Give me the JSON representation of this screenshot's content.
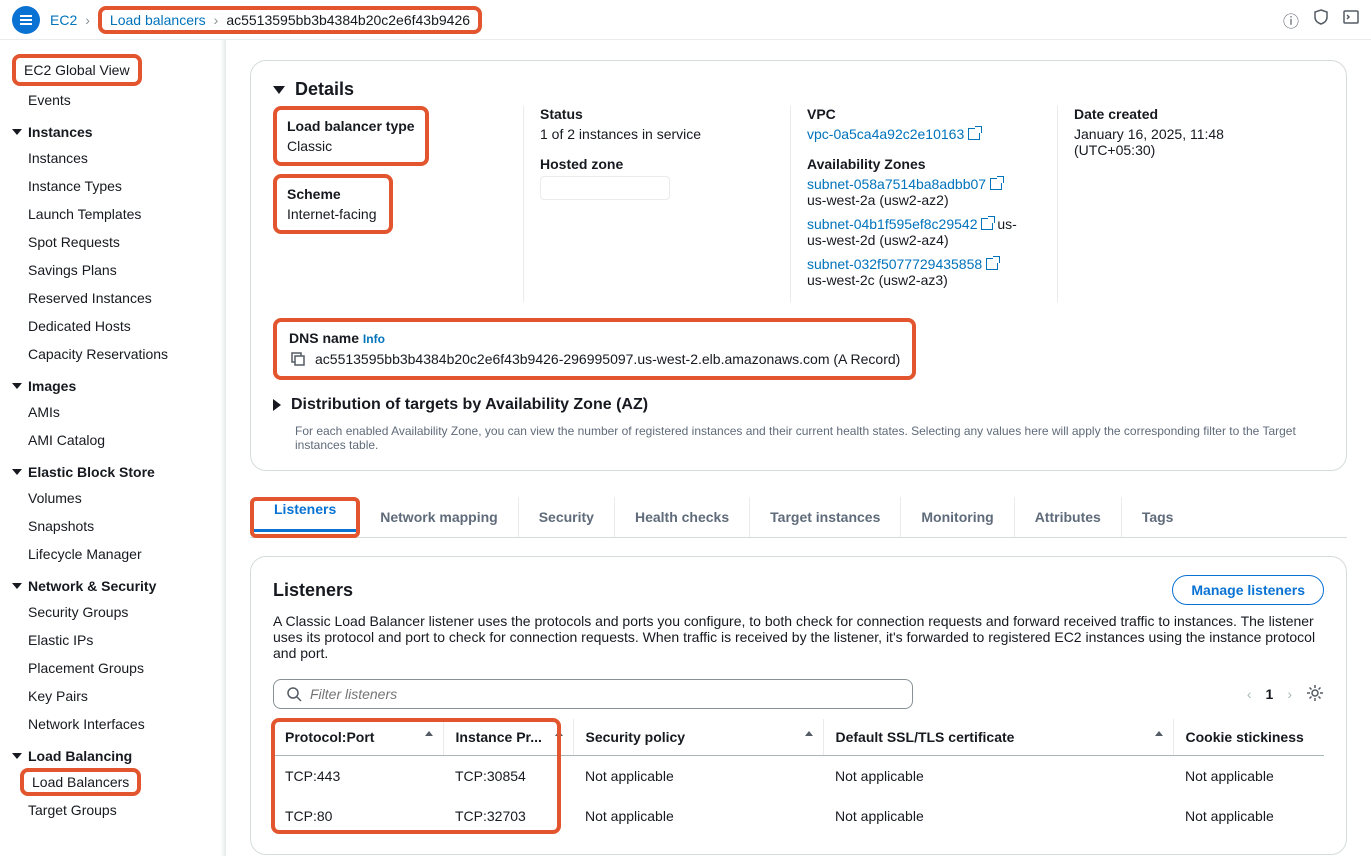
{
  "breadcrumb": {
    "root": "EC2",
    "parent": "Load balancers",
    "current": "ac5513595bb3b4384b20c2e6f43b9426"
  },
  "sidebar": {
    "global_view": "EC2 Global View",
    "events": "Events",
    "groups": [
      {
        "title": "Instances",
        "items": [
          "Instances",
          "Instance Types",
          "Launch Templates",
          "Spot Requests",
          "Savings Plans",
          "Reserved Instances",
          "Dedicated Hosts",
          "Capacity Reservations"
        ]
      },
      {
        "title": "Images",
        "items": [
          "AMIs",
          "AMI Catalog"
        ]
      },
      {
        "title": "Elastic Block Store",
        "items": [
          "Volumes",
          "Snapshots",
          "Lifecycle Manager"
        ]
      },
      {
        "title": "Network & Security",
        "items": [
          "Security Groups",
          "Elastic IPs",
          "Placement Groups",
          "Key Pairs",
          "Network Interfaces"
        ]
      },
      {
        "title": "Load Balancing",
        "items": [
          "Load Balancers",
          "Target Groups"
        ]
      }
    ]
  },
  "details": {
    "section_title": "Details",
    "lb_type_label": "Load balancer type",
    "lb_type_value": "Classic",
    "scheme_label": "Scheme",
    "scheme_value": "Internet-facing",
    "status_label": "Status",
    "status_value": "1 of 2 instances in service",
    "hosted_zone_label": "Hosted zone",
    "vpc_label": "VPC",
    "vpc_link": "vpc-0a5ca4a92c2e10163",
    "az_label": "Availability Zones",
    "subnets": [
      {
        "link": "subnet-058a7514ba8adbb07",
        "desc": "us-west-2a (usw2-az2)",
        "trail": ""
      },
      {
        "link": "subnet-04b1f595ef8c29542",
        "desc": "us-west-2d (usw2-az4)",
        "trail": "us-"
      },
      {
        "link": "subnet-032f5077729435858",
        "desc": "us-west-2c (usw2-az3)",
        "trail": ""
      }
    ],
    "date_label": "Date created",
    "date_value": "January 16, 2025, 11:48 (UTC+05:30)",
    "dns_label": "DNS name",
    "info": "Info",
    "dns_value": "ac5513595bb3b4384b20c2e6f43b9426-296995097.us-west-2.elb.amazonaws.com (A Record)",
    "dist_title": "Distribution of targets by Availability Zone (AZ)",
    "dist_desc": "For each enabled Availability Zone, you can view the number of registered instances and their current health states. Selecting any values here will apply the corresponding filter to the Target instances table."
  },
  "tabs": [
    "Listeners",
    "Network mapping",
    "Security",
    "Health checks",
    "Target instances",
    "Monitoring",
    "Attributes",
    "Tags"
  ],
  "listeners": {
    "title": "Listeners",
    "manage_btn": "Manage listeners",
    "desc": "A Classic Load Balancer listener uses the protocols and ports you configure, to both check for connection requests and forward received traffic to instances. The listener uses its protocol and port to check for connection requests. When traffic is received by the listener, it's forwarded to registered EC2 instances using the instance protocol and port.",
    "filter_placeholder": "Filter listeners",
    "page": "1",
    "columns": [
      "Protocol:Port",
      "Instance Pr...",
      "Security policy",
      "Default SSL/TLS certificate",
      "Cookie stickiness"
    ],
    "rows": [
      {
        "proto": "TCP:443",
        "inst": "TCP:30854",
        "sec": "Not applicable",
        "ssl": "Not applicable",
        "cookie": "Not applicable"
      },
      {
        "proto": "TCP:80",
        "inst": "TCP:32703",
        "sec": "Not applicable",
        "ssl": "Not applicable",
        "cookie": "Not applicable"
      }
    ]
  }
}
